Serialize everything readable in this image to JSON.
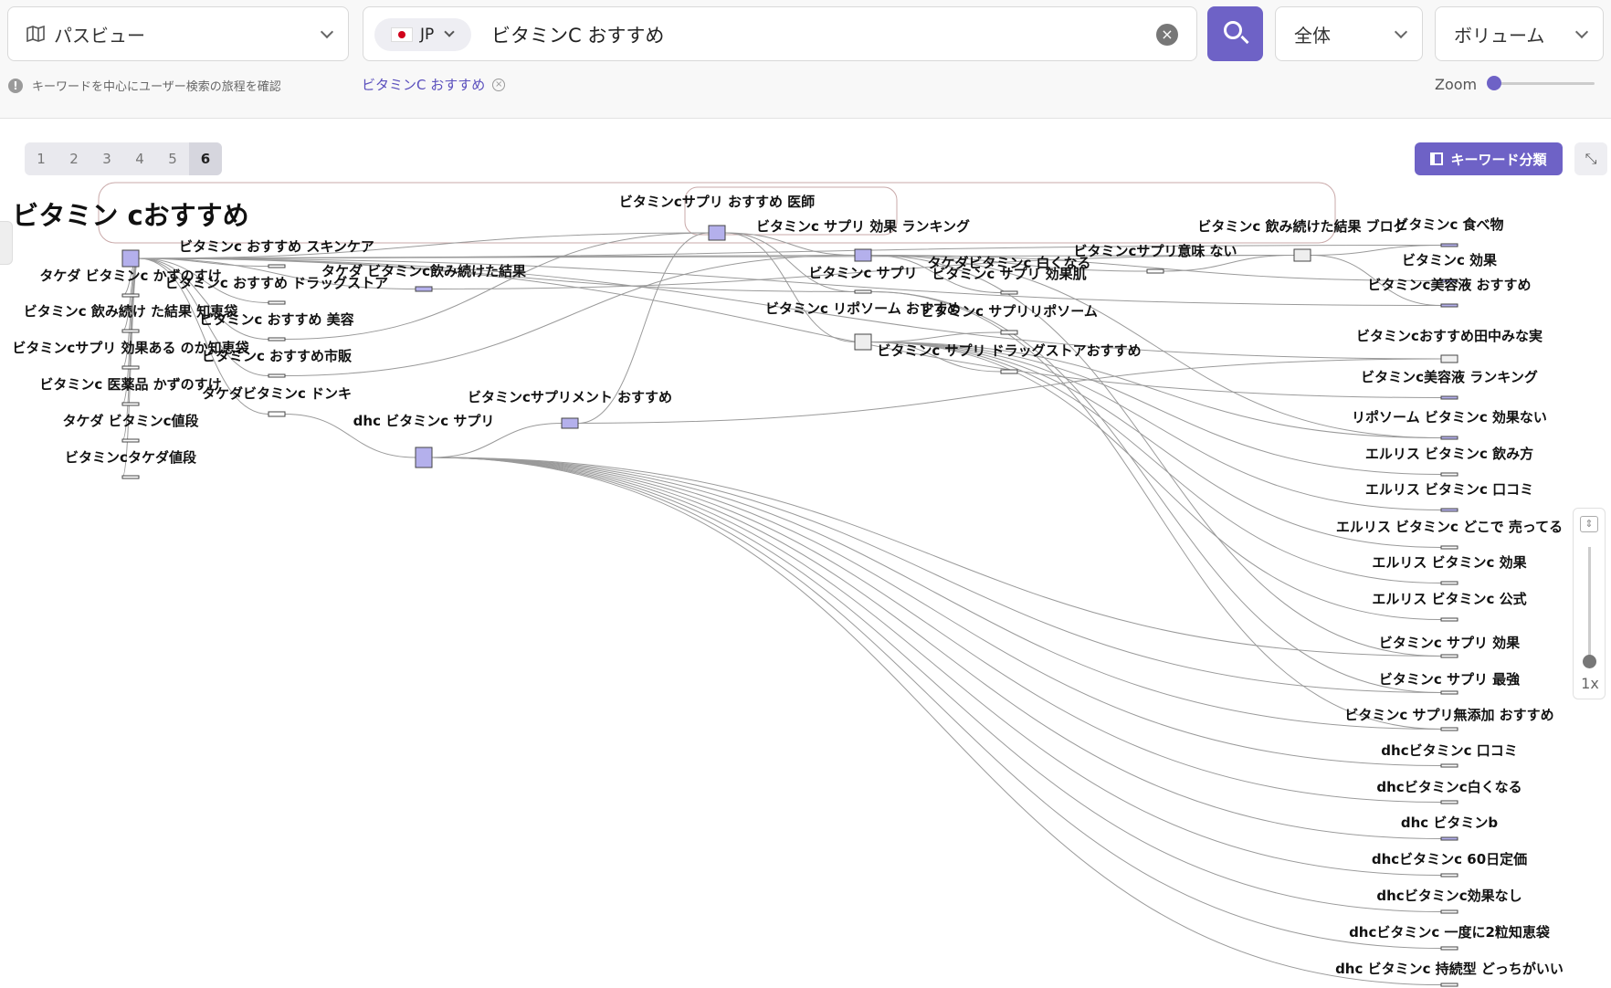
{
  "toolbar": {
    "view_select": {
      "icon": "map-icon",
      "value": "パスビュー"
    },
    "country": {
      "code": "JP",
      "flag_colors": {
        "field": "#ffffff",
        "disc": "#d0021b"
      }
    },
    "search_value": "ビタミンC おすすめ",
    "scope_select": "全体",
    "sort_select": "ボリューム",
    "accent_color": "#6e62c6"
  },
  "hint": "キーワードを中心にユーザー検索の旅程を確認",
  "chip": {
    "label": "ビタミンC おすすめ"
  },
  "zoom": {
    "label": "Zoom",
    "value": 0
  },
  "pager": [
    "1",
    "2",
    "3",
    "4",
    "5",
    "6"
  ],
  "pager_active": "6",
  "keyword_button": "キーワード分類",
  "vertical_zoom": {
    "label": "1x"
  },
  "graph": {
    "root": "ビタミン cおすすめ",
    "labels": {
      "c1": "ビタミンc おすすめ スキンケア",
      "c2": "タケダ ビタミンc かずのすけ",
      "c3": "ビタミンc おすすめ ドラッグストア",
      "c4": "ビタミンc 飲み続け た結果 知恵袋",
      "c5": "ビタミンc おすすめ 美容",
      "c6": "ビタミンcサプリ 効果ある のか知恵袋",
      "c7": "ビタミンc おすすめ市販",
      "c8": "ビタミンc 医薬品 かずのすけ",
      "c9": "タケダビタミンc ドンキ",
      "c10": "タケダ ビタミンc値段",
      "c11": "ビタミンcタケダ値段",
      "m1": "タケダ ビタミンc飲み続けた結果",
      "m2": "ビタミンcサプリメント おすすめ",
      "m3": "dhc ビタミンc サプリ",
      "t1": "ビタミンcサプリ おすすめ 医師",
      "t2": "ビタミンc サプリ 効果 ランキング",
      "t3": "ビタミンc サプリ",
      "t4": "タケダビタミンc 白くなる",
      "t5": "ビタミンc サプリ 効果肌",
      "t6": "ビタミンcサプリ意味 ない",
      "t7": "ビタミンc 飲み続けた結果 ブログ",
      "t8": "ビタミンc リポソーム おすすめ",
      "t9": "ビタミンc サプリリポソーム",
      "t10": "ビタミンc サプリ ドラッグストアおすすめ",
      "r1": "ビタミンc 食べ物",
      "r2": "ビタミンc 効果",
      "r3": "ビタミンc美容液 おすすめ",
      "r4": "ビタミンcおすすめ田中みな実",
      "r5": "ビタミンc美容液 ランキング",
      "r6": "リポソーム ビタミンc 効果ない",
      "r7": "エルリス ビタミンc 飲み方",
      "r8": "エルリス ビタミンc 口コミ",
      "r9": "エルリス ビタミンc どこで 売ってる",
      "r10": "エルリス ビタミンc 効果",
      "r11": "エルリス ビタミンc 公式",
      "r12": "ビタミンc サプリ 効果",
      "r13": "ビタミンc サプリ 最強",
      "r14": "ビタミンc サプリ無添加 おすすめ",
      "r15": "dhcビタミンc 口コミ",
      "r16": "dhcビタミンc白くなる",
      "r17": "dhc ビタミンb",
      "r18": "dhcビタミンc 60日定価",
      "r19": "dhcビタミンc効果なし",
      "r20": "dhcビタミンc 一度に2粒知恵袋",
      "r21": "dhc ビタミンc 持続型 どっちがいい"
    }
  }
}
